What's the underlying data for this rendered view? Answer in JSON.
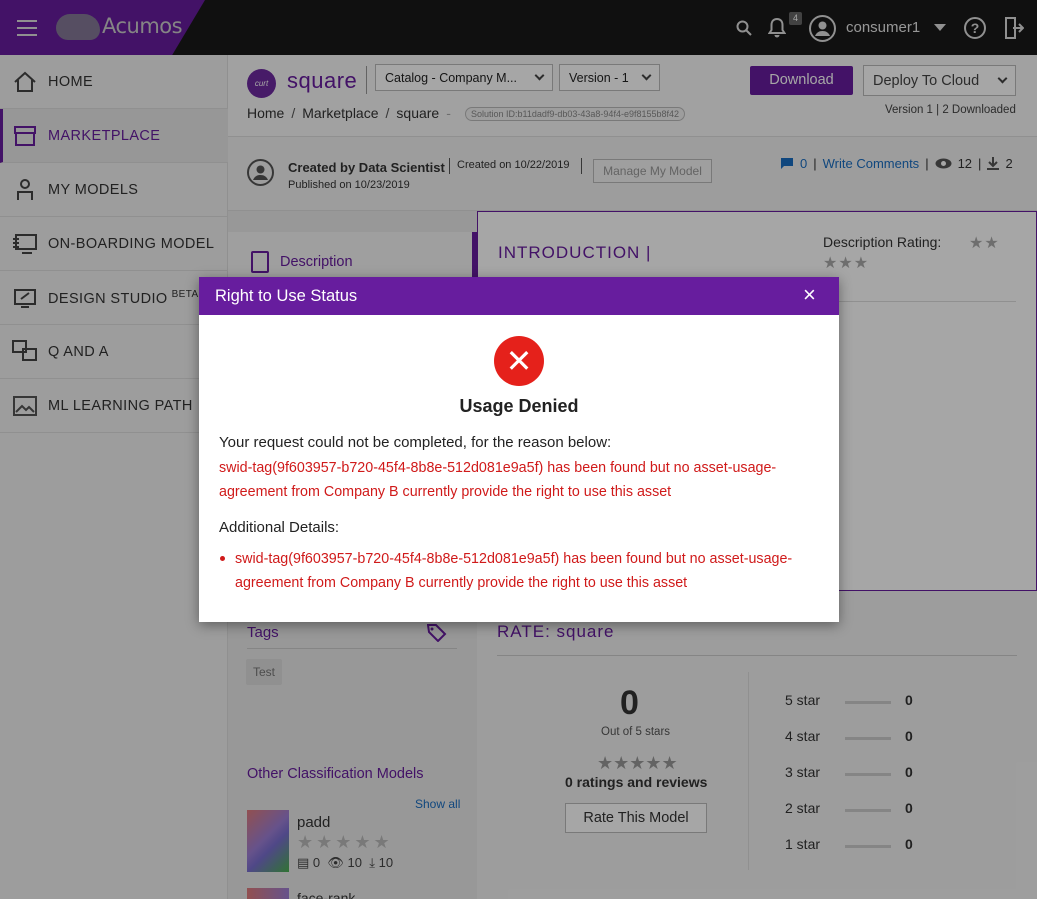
{
  "topbar": {
    "brand": "Acumos",
    "notification_count": "4",
    "username": "consumer1",
    "help_glyph": "?"
  },
  "sidebar": {
    "items": [
      {
        "label": "HOME",
        "icon": "home-icon"
      },
      {
        "label": "MARKETPLACE",
        "icon": "marketplace-icon",
        "active": true
      },
      {
        "label": "MY MODELS",
        "icon": "my-models-icon"
      },
      {
        "label": "ON-BOARDING MODEL",
        "icon": "onboarding-icon"
      },
      {
        "label": "DESIGN STUDIO",
        "icon": "design-studio-icon",
        "badge": "BETA"
      },
      {
        "label": "Q AND A",
        "icon": "q-and-a-icon"
      },
      {
        "label": "ML LEARNING PATH",
        "icon": "learning-path-icon"
      }
    ]
  },
  "header": {
    "model_avatar_text": "curt",
    "model_name": "square",
    "catalog_select": "Catalog - Company M...",
    "version_select": "Version - 1",
    "download_label": "Download",
    "deploy_label": "Deploy To Cloud",
    "breadcrumb": [
      "Home",
      "Marketplace",
      "square"
    ],
    "breadcrumb_sep": "/",
    "breadcrumb_dash": "-",
    "solution_id": "Solution ID:b11dadf9-db03-43a8-94f4-e9f8155b8f42",
    "version_info": "Version 1 | 2 Downloaded"
  },
  "creator": {
    "created_by": "Created by Data Scientist",
    "created_on": "Created on 10/22/2019",
    "published_on": "Published on 10/23/2019",
    "manage_label": "Manage My Model",
    "comments_count": "0",
    "write_comments": "Write Comments",
    "views": "12",
    "downloads": "2",
    "sep": "|"
  },
  "content": {
    "description_tab": "Description",
    "intro_heading": "INTRODUCTION |",
    "description_rating_label": "Description Rating:",
    "tags_title": "Tags",
    "tags": [
      "Test"
    ],
    "other_title": "Other Classification Models",
    "show_all": "Show all",
    "related": [
      {
        "name": "padd",
        "comments": "0",
        "views": "10",
        "downloads": "10"
      },
      {
        "name": "face-rank"
      }
    ]
  },
  "rating": {
    "title": "RATE: square",
    "average": "0",
    "out_of": "Out of 5 stars",
    "count_label": "0 ratings and reviews",
    "rate_button": "Rate This Model",
    "rows": [
      {
        "label": "5 star",
        "count": "0"
      },
      {
        "label": "4 star",
        "count": "0"
      },
      {
        "label": "3 star",
        "count": "0"
      },
      {
        "label": "2 star",
        "count": "0"
      },
      {
        "label": "1 star",
        "count": "0"
      }
    ]
  },
  "modal": {
    "title": "Right to Use Status",
    "close_glyph": "×",
    "error_glyph": "✕",
    "heading": "Usage Denied",
    "reason_label": "Your request could not be completed, for the reason below:",
    "reason_text": "swid-tag(9f603957-b720-45f4-8b8e-512d081e9a5f) has been found but no asset-usage-agreement from Company B currently provide the right to use this asset",
    "details_label": "Additional Details:",
    "details": [
      "swid-tag(9f603957-b720-45f4-8b8e-512d081e9a5f) has been found but no asset-usage-agreement from Company B currently provide the right to use this asset"
    ]
  },
  "colors": {
    "brand": "#671d9e",
    "error": "#e5211b",
    "error_text": "#d01a1a",
    "link": "#1a6ec2"
  }
}
